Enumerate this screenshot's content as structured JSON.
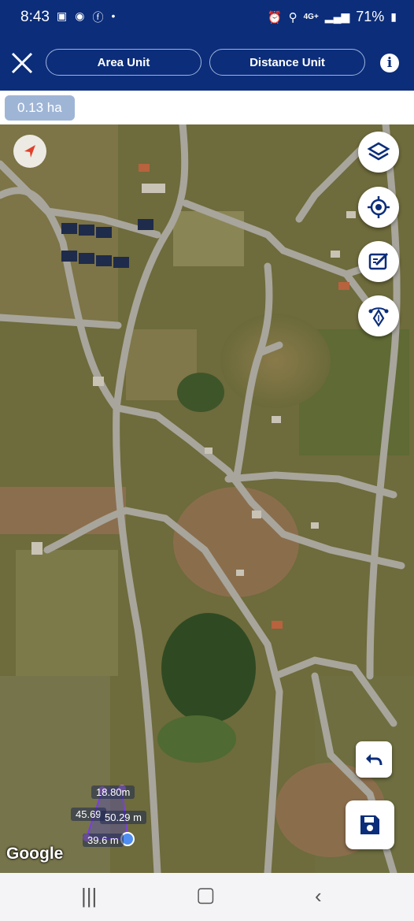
{
  "status": {
    "time": "8:43",
    "battery": "71%",
    "network": "4G+",
    "left_icons": [
      "image-icon",
      "app-icon",
      "facebook-icon",
      "dot-icon"
    ],
    "right_icons": [
      "alarm-icon",
      "location-icon",
      "signal-icon",
      "battery-icon"
    ]
  },
  "toolbar": {
    "area_unit_label": "Area Unit",
    "distance_unit_label": "Distance Unit",
    "info_label": "i"
  },
  "measurement": {
    "area": "0.13 ha"
  },
  "segments": {
    "top": "18.80m",
    "left": "45.69",
    "right": "50.29 m",
    "bottom": "39.6 m"
  },
  "map": {
    "attribution": "Google"
  },
  "colors": {
    "header": "#0b2d7a",
    "chip": "#9fb5d6",
    "accent": "#2a5bd7"
  }
}
